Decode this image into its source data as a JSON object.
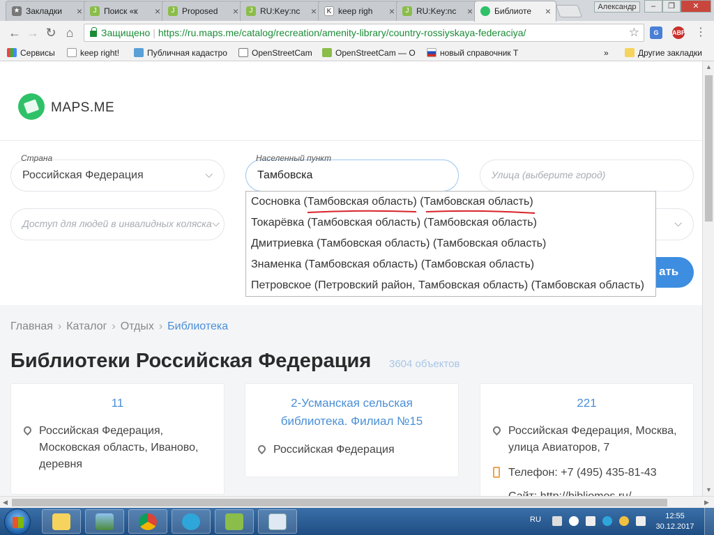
{
  "browser": {
    "tabs": [
      {
        "label": "Закладки",
        "color": "#777777",
        "glyph": "★"
      },
      {
        "label": "Поиск «к",
        "color": "#8bbd4a",
        "glyph": "J"
      },
      {
        "label": "Proposed",
        "color": "#8bbd4a",
        "glyph": "J"
      },
      {
        "label": "RU:Key:nc",
        "color": "#8bbd4a",
        "glyph": "J"
      },
      {
        "label": "keep righ",
        "color": "#ffffff",
        "glyph": "K"
      },
      {
        "label": "RU:Key:nc",
        "color": "#8bbd4a",
        "glyph": "J"
      },
      {
        "label": "Библиоте",
        "color": "#2fc168",
        "glyph": "●"
      }
    ],
    "user": "Александр",
    "secure_label": "Защищено",
    "url": "https://ru.maps.me/catalog/recreation/amenity-library/country-rossiyskaya-federaciya/",
    "bookmarks": [
      "Сервисы",
      "keep right!",
      "Публичная кадастро",
      "OpenStreetCam",
      "OpenStreetCam — О",
      "новый справочник Т",
      "»",
      "Другие закладки"
    ],
    "ext_translate": "G",
    "ext_abp": "ABP"
  },
  "site": {
    "logo": "MAPS.ME",
    "filters": {
      "country_label": "Страна",
      "country_value": "Российская Федерация",
      "city_label": "Населенный пункт",
      "city_value": "Тамбовска",
      "street_placeholder": "Улица (выберите город)",
      "access_placeholder": "Доступ для людей в инвалидных колясках",
      "show_button": "ать"
    },
    "suggestions": [
      "Сосновка (Тамбовская область) (Тамбовская область)",
      "Токарёвка (Тамбовская область) (Тамбовская область)",
      "Дмитриевка (Тамбовская область) (Тамбовская область)",
      "Знаменка (Тамбовская область) (Тамбовская область)",
      "Петровское (Петровский район, Тамбовская область) (Тамбовская область)"
    ],
    "breadcrumb": [
      "Главная",
      "Каталог",
      "Отдых",
      "Библиотека"
    ],
    "title": "Библиотеки Российская Федерация",
    "count": "3604 объектов",
    "cards": [
      {
        "title": "11",
        "address": [
          "Российская Федерация,",
          "Московская область, Иваново,",
          "деревня"
        ]
      },
      {
        "title": [
          "2-Усманская сельская",
          "библиотека. Филиал №15"
        ],
        "address": [
          "Российская Федерация"
        ]
      },
      {
        "title": "221",
        "address": [
          "Российская Федерация, Москва,",
          "улица Авиаторов, 7"
        ],
        "phone": "Телефон: +7 (495) 435-81-43",
        "site": "Сайт: http://bibliomos.ru/"
      }
    ]
  },
  "taskbar": {
    "lang": "RU",
    "time": "12:55",
    "date": "30.12.2017"
  }
}
